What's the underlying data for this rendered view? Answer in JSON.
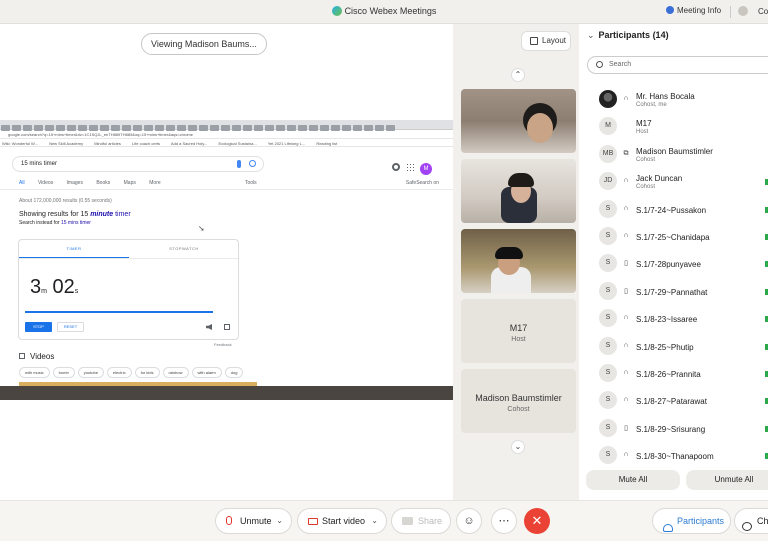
{
  "titlebar": {
    "app_title": "Cisco Webex Meetings",
    "meeting_info": "Meeting Info",
    "truncated_right": "Co"
  },
  "share": {
    "viewing_label": "Viewing Madison Baums...",
    "browser": {
      "address": "google.com/search?q=15+mins+timer&rlz=1C1SQJL_enTH889TH889&oq=15+mins+timer&aqs=chrome",
      "bookmarks": [
        "Wiki: Wonderful W...",
        "New Skill Academy",
        "Mindful articles",
        "Life coach certs",
        "Add a Sacred Holy...",
        "Ecological Sustaina...",
        "Yet 2021 Lifelong L...",
        "Reading list"
      ],
      "search_query": "15 mins timer",
      "account_initial": "M",
      "nav": [
        "All",
        "Videos",
        "Images",
        "Books",
        "Maps",
        "More"
      ],
      "tools": "Tools",
      "safesearch": "SafeSearch on",
      "results_count": "About 172,000,000 results (0.55 seconds)",
      "showing_prefix": "Showing results for 15 ",
      "showing_italic": "minute",
      "showing_suffix": " timer",
      "instead_prefix": "Search instead for ",
      "instead_link": "15 mins timer",
      "timer": {
        "tab_timer": "TIMER",
        "tab_stopwatch": "STOPWATCH",
        "minutes": "3",
        "minutes_unit": "m",
        "seconds": "02",
        "seconds_unit": "s",
        "stop": "STOP",
        "reset": "RESET",
        "feedback": "Feedback"
      },
      "videos_heading": "Videos",
      "chips": [
        "with music",
        "bomb",
        "youtube",
        "electric",
        "for kids",
        "rainbow",
        "with alarm",
        "dog"
      ]
    }
  },
  "video": {
    "layout_label": "Layout",
    "tiles": [
      {
        "name": "M17",
        "role": "Host"
      },
      {
        "name": "Madison Baumstimler",
        "role": "Cohost"
      }
    ]
  },
  "participants": {
    "title": "Participants (14)",
    "search_placeholder": "Search",
    "list": [
      {
        "initials": "",
        "photo": true,
        "device": "headset",
        "name": "Mr. Hans Bocala",
        "role": "Cohost, me"
      },
      {
        "initials": "M",
        "device": "",
        "name": "M17",
        "role": "Host"
      },
      {
        "initials": "MB",
        "device": "share",
        "name": "Madison Baumstimler",
        "role": "Cohost"
      },
      {
        "initials": "JD",
        "device": "headset",
        "name": "Jack Duncan",
        "role": "Cohost"
      },
      {
        "initials": "S",
        "device": "headset",
        "name": "S.1/7-24~Pussakon",
        "role": ""
      },
      {
        "initials": "S",
        "device": "headset",
        "name": "S.1/7-25~Chanidapa",
        "role": ""
      },
      {
        "initials": "S",
        "device": "phone",
        "name": "S.1/7-28punyavee",
        "role": ""
      },
      {
        "initials": "S",
        "device": "phone",
        "name": "S.1/7-29~Pannathat",
        "role": ""
      },
      {
        "initials": "S",
        "device": "headset",
        "name": "S.1/8-23~Issaree",
        "role": ""
      },
      {
        "initials": "S",
        "device": "headset",
        "name": "S.1/8-25~Phutip",
        "role": ""
      },
      {
        "initials": "S",
        "device": "headset",
        "name": "S.1/8-26~Prannita",
        "role": ""
      },
      {
        "initials": "S",
        "device": "headset",
        "name": "S.1/8-27~Patarawat",
        "role": ""
      },
      {
        "initials": "S",
        "device": "phone",
        "name": "S.1/8-29~Srisurang",
        "role": ""
      },
      {
        "initials": "S",
        "device": "headset",
        "name": "S.1/8-30~Thanapoom",
        "role": ""
      }
    ],
    "mute_all": "Mute All",
    "unmute_all": "Unmute All"
  },
  "controls": {
    "unmute": "Unmute",
    "start_video": "Start video",
    "share": "Share",
    "reactions_icon": "smiley-icon",
    "more_icon": "ellipsis-icon",
    "end_icon": "close-icon",
    "participants": "Participants",
    "chat": "Ch"
  },
  "colors": {
    "accent_blue": "#2b7cd3",
    "mute_red": "#e0362c",
    "end_red": "#ea4335",
    "google_blue": "#1a73e8"
  }
}
